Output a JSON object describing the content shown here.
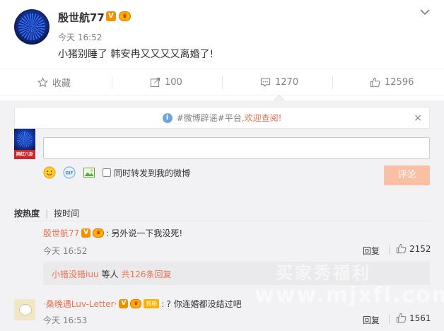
{
  "post": {
    "username": "殷世航77",
    "v_badge": "V",
    "crown_badge": "♛",
    "time": "今天 16:52",
    "text": "小猪别睡了 韩安冉又又又又离婚了!"
  },
  "actions": {
    "collect": "收藏",
    "repost": "100",
    "comment": "1270",
    "like": "12596"
  },
  "notice": {
    "icon": "i",
    "text": "#微博辟谣#平台,",
    "link": "欢迎查阅!",
    "close": "×"
  },
  "composer": {
    "avatar_brand": "网红八卦",
    "repost_label": "同时转发到我的微博",
    "submit": "评论"
  },
  "sort": {
    "hot": "按热度",
    "divider": "|",
    "time": "按时间"
  },
  "comments": [
    {
      "name": "殷世航77",
      "colon": ":",
      "text": "另外说一下我没死!",
      "time": "今天 16:52",
      "reply": "回复",
      "likes": "2152",
      "sub_user": "小错没错iuu",
      "sub_mid": "等人",
      "sub_count": "共126条回复"
    },
    {
      "name": "·桑晚遇Luv-Letter·",
      "fan_badge": "铁粉",
      "colon": ":",
      "text": "? 你连婚都没结过吧",
      "time": "今天 16:53",
      "reply": "回复",
      "likes": "1561"
    }
  ],
  "watermark": {
    "line1": "买家秀福利",
    "line2": "www.mjxfl.com"
  },
  "colors": {
    "accent": "#eb7350",
    "v_badge": "#f29100",
    "submit_disabled": "#fbbfa4",
    "panel_bg": "#f2f2f5"
  }
}
